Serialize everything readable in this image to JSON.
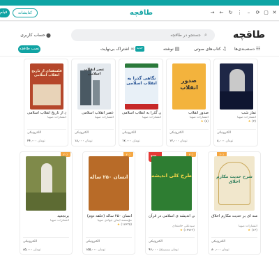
{
  "topbar": {
    "primary_label": "فیلم",
    "outline_label": "کتابشانه",
    "logo": "طاقچه",
    "icons": [
      "refresh-icon",
      "menu-icon",
      "minimize-icon",
      "maximize-icon",
      "close-icon",
      "sync-icon",
      "back-icon",
      "forward-icon"
    ]
  },
  "header": {
    "logo": "طاقچه",
    "search_placeholder": "جستجو در طاقچه",
    "account_label": "حساب کاربری"
  },
  "nav": {
    "items": [
      {
        "label": "دسته‌بندی‌ها",
        "icon": "grid-icon"
      },
      {
        "label": "کتاب‌های صوتی",
        "icon": "headphones-icon"
      },
      {
        "label": "نوشته",
        "icon": "document-icon",
        "badge": "جدید"
      },
      {
        "label": "اشتراک بی‌نهایت",
        "icon": "infinity-icon"
      }
    ],
    "install_label": "نصب طاقچه"
  },
  "books": [
    {
      "title": "نماز شب",
      "publisher": "انتشارات صهبا",
      "rating": "(۴)",
      "format": "الکترونیکی",
      "price": "۸,۰۰۰",
      "currency": "تومان"
    },
    {
      "title": "صدور انقلاب",
      "publisher": "انتشارات صهبا",
      "rating": "(۵)",
      "format": "الکترونیکی",
      "price": "۱۲,۰۰۰",
      "currency": "تومان"
    },
    {
      "title": "نگاهی گذرا به انقلاب اسلامی",
      "publisher": "انتشارات صهبا",
      "rating": "",
      "format": "الکترونیکی",
      "price": "۱۲,۰۰۰",
      "currency": "تومان"
    },
    {
      "title": "عصر انقلاب اسلامی",
      "publisher": "انتشارات صهبا",
      "rating": "",
      "format": "الکترونیکی",
      "price": "۱۸,۰۰۰",
      "currency": "تومان"
    },
    {
      "title": "فلسفه‌ای از تاریخ انقلاب اسلامی",
      "publisher": "انتشارات صهبا",
      "rating": "",
      "format": "الکترونیکی",
      "price": "۲۴,۰۰۰",
      "currency": "تومان"
    },
    {
      "title": "شرح حضرت آیت الله خامنه ای بر حدیث مکارم اخلاق",
      "publisher": "انتشارات صهبا",
      "rating": "(۱۴)",
      "format": "الکترونیکی",
      "price": "۸۰,۰۰۰",
      "currency": "تومان",
      "discount": "۲۰٪"
    },
    {
      "title": "طرح کلی اندیشه ی اسلامی در قرآن",
      "publisher": "سیدعلی خامنه‌ای",
      "rating": "(۱۴۷۶۳)",
      "format": "الکترونیکی",
      "price": "۹۶,۰۰۰",
      "old_price": "۱۲۰,۰۰۰",
      "currency": "تومان",
      "discount": "۲۰٪",
      "big_badge": "۲۵۰"
    },
    {
      "title": "انسان ۲۵۰ ساله (حلقه دوم)",
      "publisher": "مؤسسه ایمان جهادی صهبا",
      "rating": "(۱۷۶۳۵)",
      "format": "الکترونیکی",
      "price": "۱۵۵,۰۰۰",
      "currency": "تومان",
      "discount": "۲۰٪"
    },
    {
      "title": "برنجعید",
      "publisher": "انتشارات صهبا",
      "rating": "",
      "format": "الکترونیکی",
      "price": "۸۵,۰۰۰",
      "currency": "تومان",
      "discount": "۲۰٪"
    }
  ],
  "covers": [
    {
      "text": "",
      "bg": "#1e2746",
      "fg": "#ffffff"
    },
    {
      "text": "صدور انقلاب",
      "bg": "#f3b33d",
      "fg": "#2d2d2d"
    },
    {
      "text": "نگاهی گذرا به انقلاب اسلامی",
      "bg": "#e8f0f7",
      "fg": "#1f4c8f"
    },
    {
      "text": "عصر انقلاب اسلامی",
      "bg": "#e4e9ee",
      "fg": "#333333"
    },
    {
      "text": "فلسفه‌ای از تاریخ انقلاب اسلامی",
      "bg": "#b5472b",
      "fg": "#fff3d6"
    },
    {
      "text": "شرح حدیث مکارم اخلاق",
      "bg": "#f1e7cc",
      "fg": "#2e7d5b"
    },
    {
      "text": "طرح کلی اندیشه",
      "bg": "#2e7d32",
      "fg": "#f6d74a"
    },
    {
      "text": "انسان ۲۵۰ ساله",
      "bg": "#b86b28",
      "fg": "#fff2d8"
    },
    {
      "text": "",
      "bg": "#7f8a4a",
      "fg": "#ffffff"
    }
  ]
}
